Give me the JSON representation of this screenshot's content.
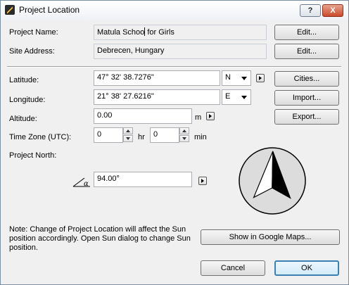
{
  "window": {
    "title": "Project Location",
    "help_label": "?",
    "close_label": "X"
  },
  "project_name": {
    "label": "Project Name:",
    "value": "Matula Schoo",
    "value_after_cursor": "for Girls",
    "button": "Edit..."
  },
  "site_address": {
    "label": "Site Address:",
    "value": "Debrecen, Hungary",
    "button": "Edit..."
  },
  "latitude": {
    "label": "Latitude:",
    "value": "47° 32' 38.7276\"",
    "hemisphere": "N"
  },
  "longitude": {
    "label": "Longitude:",
    "value": "21° 38' 27.6216\"",
    "hemisphere": "E"
  },
  "altitude": {
    "label": "Altitude:",
    "value": "0.00",
    "unit": "m"
  },
  "time_zone": {
    "label": "Time Zone (UTC):",
    "hours": "0",
    "hours_unit": "hr",
    "minutes": "0",
    "minutes_unit": "min"
  },
  "project_north": {
    "label": "Project North:",
    "value": "94.00°",
    "angle_symbol": "α",
    "angle_deg": 94
  },
  "side_buttons": {
    "cities": "Cities...",
    "import": "Import...",
    "export": "Export..."
  },
  "note": "Note: Change of Project Location will affect the Sun position accordingly. Open Sun dialog to change Sun position.",
  "google_maps_button": "Show in Google Maps...",
  "footer": {
    "cancel": "Cancel",
    "ok": "OK"
  },
  "colors": {
    "accent": "#3c7fb1",
    "close": "#c94a2d",
    "window_bg": "#f0f0f0"
  },
  "icons": {
    "app": "archicad-icon",
    "angle": "angle-icon",
    "compass": "north-compass-icon"
  }
}
